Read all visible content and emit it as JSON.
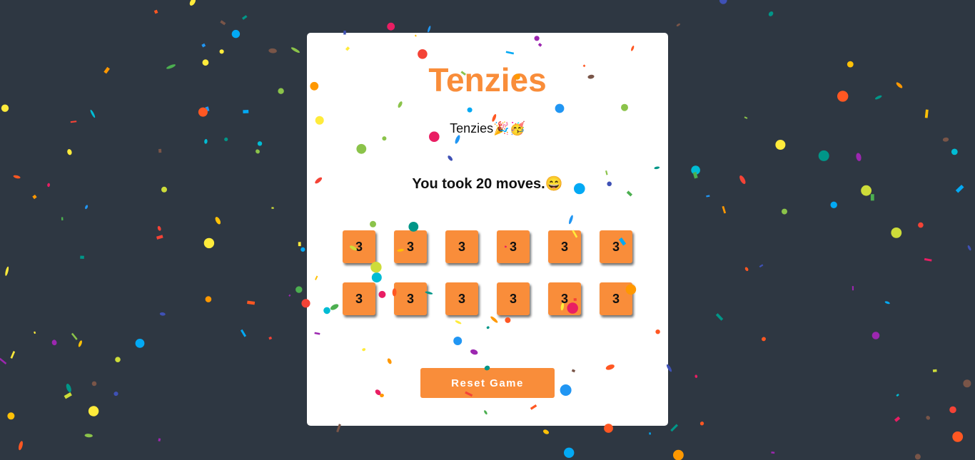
{
  "game": {
    "title": "Tenzies",
    "subtitle": "Tenzies🎉🥳",
    "moves_text": "You took 20 moves.😄",
    "reset_label": "Reset Game"
  },
  "dice": [
    "3",
    "3",
    "3",
    "3",
    "3",
    "3",
    "3",
    "3",
    "3",
    "3",
    "3",
    "3"
  ],
  "colors": {
    "background": "#2e3742",
    "accent": "#f98d3a",
    "card": "#ffffff",
    "confetti": [
      "#f44336",
      "#e91e63",
      "#9c27b0",
      "#3f51b5",
      "#2196f3",
      "#03a9f4",
      "#00bcd4",
      "#009688",
      "#4caf50",
      "#8bc34a",
      "#cddc39",
      "#ffeb3b",
      "#ffc107",
      "#ff9800",
      "#ff5722",
      "#795548"
    ]
  }
}
